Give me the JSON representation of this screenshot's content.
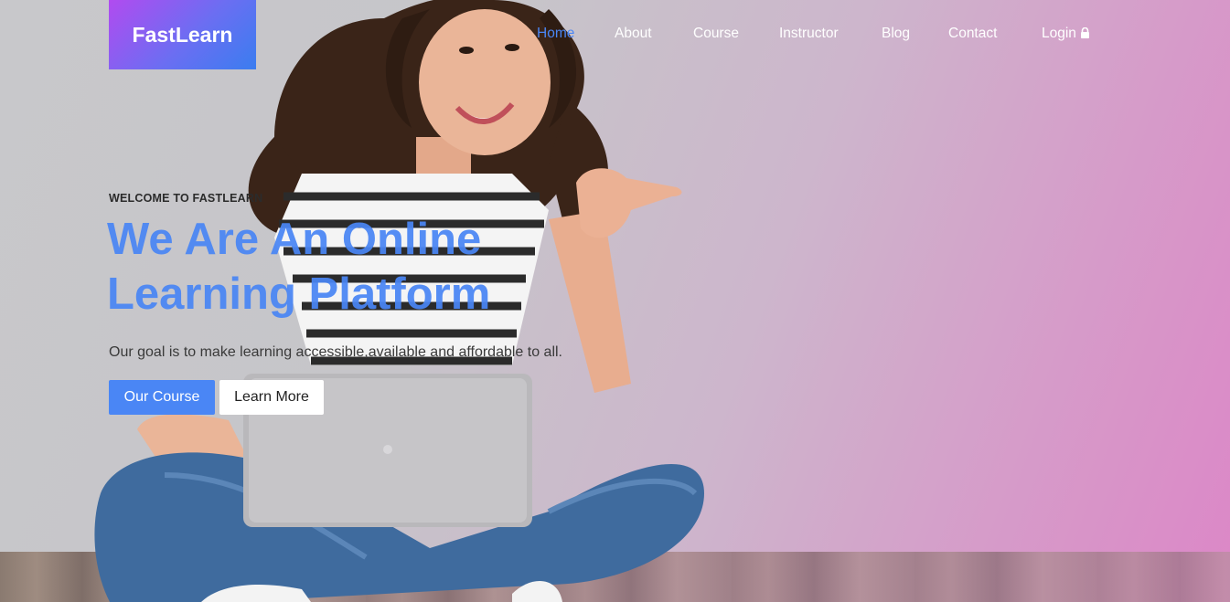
{
  "brand": {
    "name": "FastLearn"
  },
  "nav": {
    "items": [
      {
        "label": "Home",
        "active": true
      },
      {
        "label": "About"
      },
      {
        "label": "Course"
      },
      {
        "label": "Instructor"
      },
      {
        "label": "Blog"
      },
      {
        "label": "Contact"
      },
      {
        "label": "Login",
        "icon": "lock-icon"
      }
    ]
  },
  "hero": {
    "eyebrow": "WELCOME TO FASTLEARN",
    "headline_line1": "We Are An Online",
    "headline_line2": "Learning Platform",
    "subtitle": "Our goal is to make learning accessible,available and affordable to all.",
    "primary_button": "Our Course",
    "secondary_button": "Learn More"
  },
  "colors": {
    "accent": "#4a86f5",
    "logo_gradient_start": "#b14bf0",
    "logo_gradient_end": "#3a7df0",
    "hero_overlay": "#dc87c7"
  }
}
